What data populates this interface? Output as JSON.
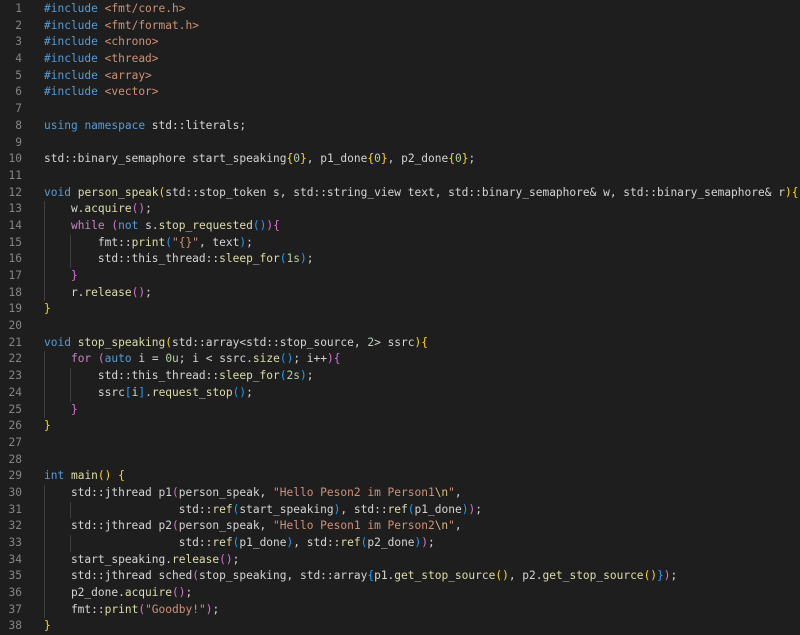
{
  "editor": {
    "language": "cpp",
    "theme": "dark",
    "lines": [
      {
        "n": "1",
        "indent": 0,
        "tokens": [
          [
            "pp",
            "#include"
          ],
          [
            "pl",
            " "
          ],
          [
            "inc",
            "<fmt/core.h>"
          ]
        ]
      },
      {
        "n": "2",
        "indent": 0,
        "tokens": [
          [
            "pp",
            "#include"
          ],
          [
            "pl",
            " "
          ],
          [
            "inc",
            "<fmt/format.h>"
          ]
        ]
      },
      {
        "n": "3",
        "indent": 0,
        "tokens": [
          [
            "pp",
            "#include"
          ],
          [
            "pl",
            " "
          ],
          [
            "inc",
            "<chrono>"
          ]
        ]
      },
      {
        "n": "4",
        "indent": 0,
        "tokens": [
          [
            "pp",
            "#include"
          ],
          [
            "pl",
            " "
          ],
          [
            "inc",
            "<thread>"
          ]
        ]
      },
      {
        "n": "5",
        "indent": 0,
        "tokens": [
          [
            "pp",
            "#include"
          ],
          [
            "pl",
            " "
          ],
          [
            "inc",
            "<array>"
          ]
        ]
      },
      {
        "n": "6",
        "indent": 0,
        "tokens": [
          [
            "pp",
            "#include"
          ],
          [
            "pl",
            " "
          ],
          [
            "inc",
            "<vector>"
          ]
        ]
      },
      {
        "n": "7",
        "indent": 0,
        "tokens": []
      },
      {
        "n": "8",
        "indent": 0,
        "tokens": [
          [
            "kw",
            "using"
          ],
          [
            "pl",
            " "
          ],
          [
            "kw",
            "namespace"
          ],
          [
            "pl",
            " std::literals;"
          ]
        ]
      },
      {
        "n": "9",
        "indent": 0,
        "tokens": []
      },
      {
        "n": "10",
        "indent": 0,
        "tokens": [
          [
            "pl",
            "std::binary_semaphore start_speaking"
          ],
          [
            "b1",
            "{"
          ],
          [
            "num",
            "0"
          ],
          [
            "b1",
            "}"
          ],
          [
            "pl",
            ", p1_done"
          ],
          [
            "b1",
            "{"
          ],
          [
            "num",
            "0"
          ],
          [
            "b1",
            "}"
          ],
          [
            "pl",
            ", p2_done"
          ],
          [
            "b1",
            "{"
          ],
          [
            "num",
            "0"
          ],
          [
            "b1",
            "}"
          ],
          [
            "pl",
            ";"
          ]
        ]
      },
      {
        "n": "11",
        "indent": 0,
        "tokens": []
      },
      {
        "n": "12",
        "indent": 0,
        "tokens": [
          [
            "kw",
            "void"
          ],
          [
            "pl",
            " "
          ],
          [
            "fn",
            "person_speak"
          ],
          [
            "b1",
            "("
          ],
          [
            "pl",
            "std::stop_token s, std::string_view text, std::binary_semaphore& w, std::binary_semaphore& r"
          ],
          [
            "b1",
            ")"
          ],
          [
            "b1",
            "{"
          ]
        ]
      },
      {
        "n": "13",
        "indent": 1,
        "tokens": [
          [
            "pl",
            "    w."
          ],
          [
            "fn",
            "acquire"
          ],
          [
            "b2",
            "()"
          ],
          [
            "pl",
            ";"
          ]
        ]
      },
      {
        "n": "14",
        "indent": 1,
        "tokens": [
          [
            "pl",
            "    "
          ],
          [
            "ctl",
            "while"
          ],
          [
            "pl",
            " "
          ],
          [
            "b2",
            "("
          ],
          [
            "kw",
            "not"
          ],
          [
            "pl",
            " s."
          ],
          [
            "fn",
            "stop_requested"
          ],
          [
            "b3",
            "()"
          ],
          [
            "b2",
            ")"
          ],
          [
            "b2",
            "{"
          ]
        ]
      },
      {
        "n": "15",
        "indent": 2,
        "tokens": [
          [
            "pl",
            "        fmt::"
          ],
          [
            "fn",
            "print"
          ],
          [
            "b3",
            "("
          ],
          [
            "str",
            "\"{}\""
          ],
          [
            "pl",
            ", text"
          ],
          [
            "b3",
            ")"
          ],
          [
            "pl",
            ";"
          ]
        ]
      },
      {
        "n": "16",
        "indent": 2,
        "tokens": [
          [
            "pl",
            "        std::this_thread::"
          ],
          [
            "fn",
            "sleep_for"
          ],
          [
            "b3",
            "("
          ],
          [
            "num",
            "1s"
          ],
          [
            "b3",
            ")"
          ],
          [
            "pl",
            ";"
          ]
        ]
      },
      {
        "n": "17",
        "indent": 1,
        "tokens": [
          [
            "pl",
            "    "
          ],
          [
            "b2",
            "}"
          ]
        ]
      },
      {
        "n": "18",
        "indent": 1,
        "tokens": [
          [
            "pl",
            "    r."
          ],
          [
            "fn",
            "release"
          ],
          [
            "b2",
            "()"
          ],
          [
            "pl",
            ";"
          ]
        ]
      },
      {
        "n": "19",
        "indent": 0,
        "tokens": [
          [
            "b1",
            "}"
          ]
        ]
      },
      {
        "n": "20",
        "indent": 0,
        "tokens": []
      },
      {
        "n": "21",
        "indent": 0,
        "tokens": [
          [
            "kw",
            "void"
          ],
          [
            "pl",
            " "
          ],
          [
            "fn",
            "stop_speaking"
          ],
          [
            "b1",
            "("
          ],
          [
            "pl",
            "std::array<std::stop_source, "
          ],
          [
            "num",
            "2"
          ],
          [
            "pl",
            "> ssrc"
          ],
          [
            "b1",
            ")"
          ],
          [
            "b1",
            "{"
          ]
        ]
      },
      {
        "n": "22",
        "indent": 1,
        "tokens": [
          [
            "pl",
            "    "
          ],
          [
            "ctl",
            "for"
          ],
          [
            "pl",
            " "
          ],
          [
            "b2",
            "("
          ],
          [
            "kw",
            "auto"
          ],
          [
            "pl",
            " i = "
          ],
          [
            "num",
            "0u"
          ],
          [
            "pl",
            "; i < ssrc."
          ],
          [
            "fn",
            "size"
          ],
          [
            "b3",
            "()"
          ],
          [
            "pl",
            "; i++"
          ],
          [
            "b2",
            ")"
          ],
          [
            "b2",
            "{"
          ]
        ]
      },
      {
        "n": "23",
        "indent": 2,
        "tokens": [
          [
            "pl",
            "        std::this_thread::"
          ],
          [
            "fn",
            "sleep_for"
          ],
          [
            "b3",
            "("
          ],
          [
            "num",
            "2s"
          ],
          [
            "b3",
            ")"
          ],
          [
            "pl",
            ";"
          ]
        ]
      },
      {
        "n": "24",
        "indent": 2,
        "tokens": [
          [
            "pl",
            "        ssrc"
          ],
          [
            "b3",
            "["
          ],
          [
            "pl",
            "i"
          ],
          [
            "b3",
            "]"
          ],
          [
            "pl",
            "."
          ],
          [
            "fn",
            "request_stop"
          ],
          [
            "b3",
            "()"
          ],
          [
            "pl",
            ";"
          ]
        ]
      },
      {
        "n": "25",
        "indent": 1,
        "tokens": [
          [
            "pl",
            "    "
          ],
          [
            "b2",
            "}"
          ]
        ]
      },
      {
        "n": "26",
        "indent": 0,
        "tokens": [
          [
            "b1",
            "}"
          ]
        ]
      },
      {
        "n": "27",
        "indent": 0,
        "tokens": []
      },
      {
        "n": "28",
        "indent": 0,
        "tokens": []
      },
      {
        "n": "29",
        "indent": 0,
        "tokens": [
          [
            "kw",
            "int"
          ],
          [
            "pl",
            " "
          ],
          [
            "fn",
            "main"
          ],
          [
            "b1",
            "()"
          ],
          [
            "pl",
            " "
          ],
          [
            "b1",
            "{"
          ]
        ]
      },
      {
        "n": "30",
        "indent": 1,
        "tokens": [
          [
            "pl",
            "    std::jthread p1"
          ],
          [
            "b2",
            "("
          ],
          [
            "pl",
            "person_speak, "
          ],
          [
            "str",
            "\"Hello Peson2 im Person1"
          ],
          [
            "esc",
            "\\n"
          ],
          [
            "str",
            "\""
          ],
          [
            "pl",
            ","
          ]
        ]
      },
      {
        "n": "31",
        "indent": 2,
        "tokens": [
          [
            "pl",
            "                    std::"
          ],
          [
            "fn",
            "ref"
          ],
          [
            "b3",
            "("
          ],
          [
            "pl",
            "start_speaking"
          ],
          [
            "b3",
            ")"
          ],
          [
            "pl",
            ", std::"
          ],
          [
            "fn",
            "ref"
          ],
          [
            "b3",
            "("
          ],
          [
            "pl",
            "p1_done"
          ],
          [
            "b3",
            ")"
          ],
          [
            "b2",
            ")"
          ],
          [
            "pl",
            ";"
          ]
        ]
      },
      {
        "n": "32",
        "indent": 1,
        "tokens": [
          [
            "pl",
            "    std::jthread p2"
          ],
          [
            "b2",
            "("
          ],
          [
            "pl",
            "person_speak, "
          ],
          [
            "str",
            "\"Hello Peson1 im Person2"
          ],
          [
            "esc",
            "\\n"
          ],
          [
            "str",
            "\""
          ],
          [
            "pl",
            ","
          ]
        ]
      },
      {
        "n": "33",
        "indent": 2,
        "tokens": [
          [
            "pl",
            "                    std::"
          ],
          [
            "fn",
            "ref"
          ],
          [
            "b3",
            "("
          ],
          [
            "pl",
            "p1_done"
          ],
          [
            "b3",
            ")"
          ],
          [
            "pl",
            ", std::"
          ],
          [
            "fn",
            "ref"
          ],
          [
            "b3",
            "("
          ],
          [
            "pl",
            "p2_done"
          ],
          [
            "b3",
            ")"
          ],
          [
            "b2",
            ")"
          ],
          [
            "pl",
            ";"
          ]
        ]
      },
      {
        "n": "34",
        "indent": 1,
        "tokens": [
          [
            "pl",
            "    start_speaking."
          ],
          [
            "fn",
            "release"
          ],
          [
            "b2",
            "()"
          ],
          [
            "pl",
            ";"
          ]
        ]
      },
      {
        "n": "35",
        "indent": 1,
        "tokens": [
          [
            "pl",
            "    std::jthread sched"
          ],
          [
            "b2",
            "("
          ],
          [
            "pl",
            "stop_speaking, std::array"
          ],
          [
            "b3",
            "{"
          ],
          [
            "pl",
            "p1."
          ],
          [
            "fn",
            "get_stop_source"
          ],
          [
            "b1",
            "()"
          ],
          [
            "pl",
            ", p2."
          ],
          [
            "fn",
            "get_stop_source"
          ],
          [
            "b1",
            "()"
          ],
          [
            "b3",
            "}"
          ],
          [
            "b2",
            ")"
          ],
          [
            "pl",
            ";"
          ]
        ]
      },
      {
        "n": "36",
        "indent": 1,
        "tokens": [
          [
            "pl",
            "    p2_done."
          ],
          [
            "fn",
            "acquire"
          ],
          [
            "b2",
            "()"
          ],
          [
            "pl",
            ";"
          ]
        ]
      },
      {
        "n": "37",
        "indent": 1,
        "tokens": [
          [
            "pl",
            "    fmt::"
          ],
          [
            "fn",
            "print"
          ],
          [
            "b2",
            "("
          ],
          [
            "str",
            "\"Goodby!\""
          ],
          [
            "b2",
            ")"
          ],
          [
            "pl",
            ";"
          ]
        ]
      },
      {
        "n": "38",
        "indent": 0,
        "tokens": [
          [
            "b1",
            "}"
          ]
        ]
      }
    ]
  }
}
